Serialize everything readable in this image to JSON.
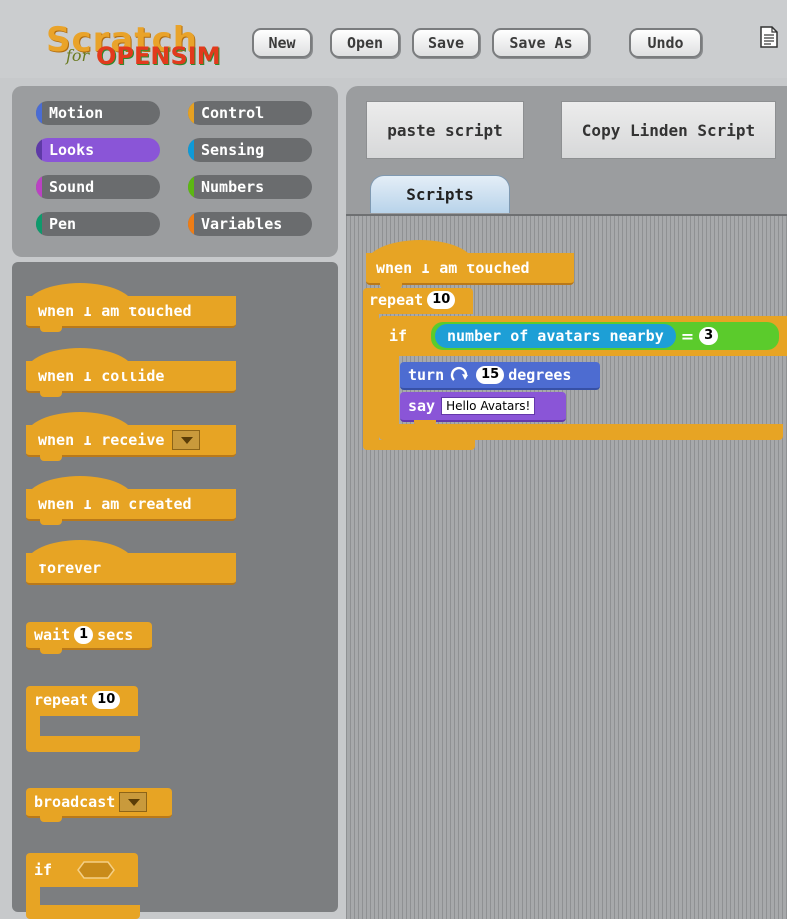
{
  "app": {
    "logo_word": "Scratch",
    "logo_for": "for",
    "logo_sim": "OPENSIM"
  },
  "toolbar": {
    "new_label": "New",
    "open_label": "Open",
    "save_label": "Save",
    "save_as_label": "Save As",
    "undo_label": "Undo"
  },
  "categories": {
    "motion": "Motion",
    "control": "Control",
    "looks": "Looks",
    "sensing": "Sensing",
    "sound": "Sound",
    "numbers": "Numbers",
    "pen": "Pen",
    "variables": "Variables",
    "selected": "Looks"
  },
  "category_colors": {
    "motion": "#4a6cd4",
    "control": "#e6a122",
    "looks": "#8a55d7",
    "sensing": "#0e9ad7",
    "sound": "#bb42c3",
    "numbers": "#5cb712",
    "pen": "#0e9a6c",
    "variables": "#ee7d16"
  },
  "palette": {
    "when_touched": "when I am touched",
    "when_collide": "when I collide",
    "when_receive": "when I receive",
    "when_created": "when I am created",
    "forever": "forever",
    "wait_prefix": "wait",
    "wait_value": "1",
    "wait_suffix": "secs",
    "repeat_label": "repeat",
    "repeat_value": "10",
    "broadcast_label": "broadcast",
    "if_label": "if"
  },
  "right": {
    "paste_script": "paste script",
    "copy_linden": "Copy Linden Script",
    "tab_scripts": "Scripts"
  },
  "script": {
    "hat": "when I am touched",
    "repeat_label": "repeat",
    "repeat_value": "10",
    "if_label": "if",
    "sensing_label": "number of avatars nearby",
    "equals": "=",
    "compare_value": "3",
    "turn_label": "turn",
    "turn_value": "15",
    "degrees_label": "degrees",
    "say_label": "say",
    "say_value": "Hello Avatars!"
  }
}
